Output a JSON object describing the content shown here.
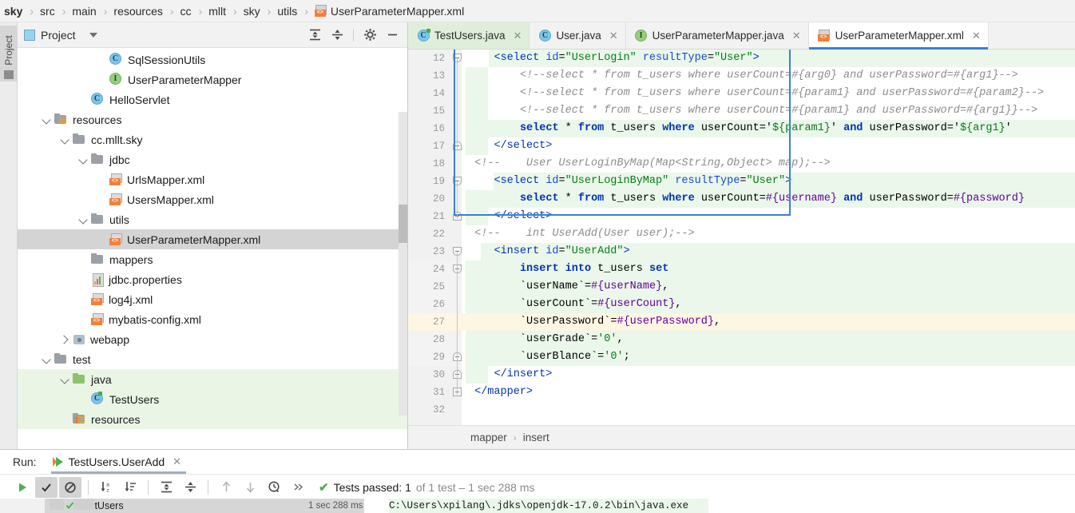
{
  "breadcrumb": {
    "items": [
      "sky",
      "src",
      "main",
      "resources",
      "cc",
      "mllt",
      "sky",
      "utils"
    ],
    "file": "UserParameterMapper.xml",
    "separator": "›"
  },
  "project_panel": {
    "title": "Project",
    "icons": [
      "expand-all-icon",
      "collapse-all-icon",
      "settings-gear-icon",
      "hide-icon"
    ],
    "vertical_tab": "Project",
    "tree": [
      {
        "label": "SqlSessionUtils",
        "icon": "java-class-icon",
        "glyph": "C",
        "indent": 5,
        "chevron": "none",
        "state": "normal"
      },
      {
        "label": "UserParameterMapper",
        "icon": "java-interface-icon",
        "glyph": "I",
        "indent": 5,
        "chevron": "none",
        "state": "normal"
      },
      {
        "label": "HelloServlet",
        "icon": "java-class-icon",
        "glyph": "C",
        "indent": 4,
        "chevron": "none",
        "state": "normal"
      },
      {
        "label": "resources",
        "icon": "resources-folder-icon",
        "glyph": "",
        "indent": 2,
        "chevron": "down",
        "state": "normal"
      },
      {
        "label": "cc.mllt.sky",
        "icon": "folder-icon",
        "glyph": "",
        "indent": 3,
        "chevron": "down",
        "state": "normal"
      },
      {
        "label": "jdbc",
        "icon": "folder-icon",
        "glyph": "",
        "indent": 4,
        "chevron": "down",
        "state": "normal"
      },
      {
        "label": "UrlsMapper.xml",
        "icon": "xml-file-icon",
        "glyph": "",
        "indent": 5,
        "chevron": "none",
        "state": "normal"
      },
      {
        "label": "UsersMapper.xml",
        "icon": "xml-file-icon",
        "glyph": "",
        "indent": 5,
        "chevron": "none",
        "state": "normal"
      },
      {
        "label": "utils",
        "icon": "folder-icon",
        "glyph": "",
        "indent": 4,
        "chevron": "down",
        "state": "normal"
      },
      {
        "label": "UserParameterMapper.xml",
        "icon": "xml-file-icon",
        "glyph": "",
        "indent": 5,
        "chevron": "none",
        "state": "selected"
      },
      {
        "label": "mappers",
        "icon": "folder-icon",
        "glyph": "",
        "indent": 4,
        "chevron": "none",
        "state": "normal"
      },
      {
        "label": "jdbc.properties",
        "icon": "properties-file-icon",
        "glyph": "",
        "indent": 4,
        "chevron": "none",
        "state": "normal"
      },
      {
        "label": "log4j.xml",
        "icon": "xml-file-icon",
        "glyph": "",
        "indent": 4,
        "chevron": "none",
        "state": "normal"
      },
      {
        "label": "mybatis-config.xml",
        "icon": "xml-file-icon",
        "glyph": "",
        "indent": 4,
        "chevron": "none",
        "state": "normal"
      },
      {
        "label": "webapp",
        "icon": "webapp-folder-icon",
        "glyph": "",
        "indent": 3,
        "chevron": "right",
        "state": "normal"
      },
      {
        "label": "test",
        "icon": "folder-icon",
        "glyph": "",
        "indent": 2,
        "chevron": "down",
        "state": "normal"
      },
      {
        "label": "java",
        "icon": "source-folder-icon",
        "glyph": "",
        "indent": 3,
        "chevron": "down",
        "state": "green"
      },
      {
        "label": "TestUsers",
        "icon": "java-test-class-icon",
        "glyph": "C",
        "indent": 4,
        "chevron": "none",
        "state": "green"
      },
      {
        "label": "resources",
        "icon": "test-resources-folder-icon",
        "glyph": "",
        "indent": 3,
        "chevron": "none",
        "state": "green"
      }
    ]
  },
  "editor": {
    "tabs": [
      {
        "label": "TestUsers.java",
        "icon": "java-test-class-icon",
        "glyph": "C",
        "style": "green",
        "close": "✕"
      },
      {
        "label": "User.java",
        "icon": "java-class-icon",
        "glyph": "C",
        "style": "plain",
        "close": "✕"
      },
      {
        "label": "UserParameterMapper.java",
        "icon": "java-interface-icon",
        "glyph": "I",
        "style": "plain",
        "close": "✕"
      },
      {
        "label": "UserParameterMapper.xml",
        "icon": "xml-file-icon",
        "glyph": "",
        "style": "active",
        "close": "✕"
      }
    ],
    "breadcrumb": {
      "items": [
        "mapper",
        "insert"
      ],
      "separator": "›"
    },
    "lines": [
      {
        "n": 12,
        "fold": "down",
        "bg": "none",
        "indent": 4,
        "tokens": [
          {
            "t": "<select ",
            "c": "s-tag"
          },
          {
            "t": "id",
            "c": "s-attr"
          },
          {
            "t": "=",
            "c": "s-punc"
          },
          {
            "t": "\"UserLogin\"",
            "c": "s-str"
          },
          {
            "t": " ",
            "c": "s-plain"
          },
          {
            "t": "resultType",
            "c": "s-attr"
          },
          {
            "t": "=",
            "c": "s-punc"
          },
          {
            "t": "\"User\"",
            "c": "s-str"
          },
          {
            "t": ">",
            "c": "s-tag"
          }
        ],
        "greenfrom": 34,
        "greenwidth": 760
      },
      {
        "n": 13,
        "fold": "none",
        "bg": "none",
        "indent": 8,
        "tokens": [
          {
            "t": "<!--select * from t_users where userCount=#{arg0} and userPassword=#{arg1}-->",
            "c": "s-com"
          }
        ],
        "greenfrom": 5,
        "greenwidth": 28
      },
      {
        "n": 14,
        "fold": "none",
        "bg": "none",
        "indent": 8,
        "tokens": [
          {
            "t": "<!--select * from t_users where userCount=#{param1} and userPassword=#{param2}-->",
            "c": "s-com"
          }
        ],
        "greenfrom": 5,
        "greenwidth": 28
      },
      {
        "n": 15,
        "fold": "none",
        "bg": "none",
        "indent": 8,
        "tokens": [
          {
            "t": "<!--select * from t_users where userCount=#{param1} and userPassword=#{arg1}}-->",
            "c": "s-com"
          }
        ],
        "greenfrom": 5,
        "greenwidth": 28
      },
      {
        "n": 16,
        "fold": "none",
        "bg": "none",
        "indent": 8,
        "tokens": [
          {
            "t": "select",
            "c": "s-kw"
          },
          {
            "t": " * ",
            "c": "s-plain"
          },
          {
            "t": "from",
            "c": "s-kw"
          },
          {
            "t": " t_users ",
            "c": "s-plain"
          },
          {
            "t": "where",
            "c": "s-kw"
          },
          {
            "t": " userCount=",
            "c": "s-plain"
          },
          {
            "t": "'",
            "c": "s-punc"
          },
          {
            "t": "${param1}",
            "c": "s-dollar"
          },
          {
            "t": "'",
            "c": "s-punc"
          },
          {
            "t": " ",
            "c": "s-plain"
          },
          {
            "t": "and",
            "c": "s-kw"
          },
          {
            "t": " userPassword=",
            "c": "s-plain"
          },
          {
            "t": "'",
            "c": "s-punc"
          },
          {
            "t": "${arg1}",
            "c": "s-dollar"
          },
          {
            "t": "'",
            "c": "s-punc"
          }
        ],
        "greenfrom": 5,
        "greenwidth": 789
      },
      {
        "n": 17,
        "fold": "up",
        "bg": "none",
        "indent": 4,
        "tokens": [
          {
            "t": "</select>",
            "c": "s-tag"
          }
        ],
        "greenfrom": 5,
        "greenwidth": 28
      },
      {
        "n": 18,
        "fold": "none",
        "bg": "none",
        "indent": 1,
        "tokens": [
          {
            "t": "<!--    User UserLoginByMap(Map<String,Object> map);-->",
            "c": "s-com"
          }
        ],
        "greenfrom": 0,
        "greenwidth": 0
      },
      {
        "n": 19,
        "fold": "down",
        "bg": "none",
        "indent": 4,
        "tokens": [
          {
            "t": "<select ",
            "c": "s-tag"
          },
          {
            "t": "id",
            "c": "s-attr"
          },
          {
            "t": "=",
            "c": "s-punc"
          },
          {
            "t": "\"UserLoginByMap\"",
            "c": "s-str"
          },
          {
            "t": " ",
            "c": "s-plain"
          },
          {
            "t": "resultType",
            "c": "s-attr"
          },
          {
            "t": "=",
            "c": "s-punc"
          },
          {
            "t": "\"User\"",
            "c": "s-str"
          },
          {
            "t": ">",
            "c": "s-tag"
          }
        ],
        "greenfrom": 40,
        "greenwidth": 754
      },
      {
        "n": 20,
        "fold": "none",
        "bg": "none",
        "indent": 8,
        "tokens": [
          {
            "t": "select",
            "c": "s-kw"
          },
          {
            "t": " * ",
            "c": "s-plain"
          },
          {
            "t": "from",
            "c": "s-kw"
          },
          {
            "t": " t_users ",
            "c": "s-plain"
          },
          {
            "t": "where",
            "c": "s-kw"
          },
          {
            "t": " userCount=",
            "c": "s-plain"
          },
          {
            "t": "#{username}",
            "c": "s-var"
          },
          {
            "t": " ",
            "c": "s-plain"
          },
          {
            "t": "and",
            "c": "s-kw"
          },
          {
            "t": " userPassword=",
            "c": "s-plain"
          },
          {
            "t": "#{password}",
            "c": "s-var"
          }
        ],
        "greenfrom": 5,
        "greenwidth": 789
      },
      {
        "n": 21,
        "fold": "up",
        "bg": "none",
        "indent": 4,
        "tokens": [
          {
            "t": "</select>",
            "c": "s-tag"
          }
        ],
        "greenfrom": 5,
        "greenwidth": 28
      },
      {
        "n": 22,
        "fold": "none",
        "bg": "none",
        "indent": 1,
        "tokens": [
          {
            "t": "<!--    int UserAdd(User user);-->",
            "c": "s-com"
          }
        ],
        "greenfrom": 0,
        "greenwidth": 0
      },
      {
        "n": 23,
        "fold": "down",
        "bg": "none",
        "indent": 4,
        "tokens": [
          {
            "t": "<insert ",
            "c": "s-tag"
          },
          {
            "t": "id",
            "c": "s-attr"
          },
          {
            "t": "=",
            "c": "s-punc"
          },
          {
            "t": "\"UserAdd\"",
            "c": "s-str"
          },
          {
            "t": ">",
            "c": "s-tag"
          }
        ],
        "greenfrom": 24,
        "greenwidth": 770
      },
      {
        "n": 24,
        "fold": "down",
        "bg": "green",
        "indent": 8,
        "tokens": [
          {
            "t": "insert",
            "c": "s-kw"
          },
          {
            "t": " ",
            "c": "s-plain"
          },
          {
            "t": "into",
            "c": "s-kw"
          },
          {
            "t": " t_users ",
            "c": "s-plain"
          },
          {
            "t": "set",
            "c": "s-kw"
          }
        ],
        "greenfrom": 5,
        "greenwidth": 789
      },
      {
        "n": 25,
        "fold": "none",
        "bg": "green",
        "indent": 8,
        "tokens": [
          {
            "t": "`userName`",
            "c": "s-plain"
          },
          {
            "t": "=",
            "c": "s-punc"
          },
          {
            "t": "#{userName}",
            "c": "s-var"
          },
          {
            "t": ",",
            "c": "s-punc"
          }
        ],
        "greenfrom": 5,
        "greenwidth": 789
      },
      {
        "n": 26,
        "fold": "none",
        "bg": "green",
        "indent": 8,
        "tokens": [
          {
            "t": "`userCount`",
            "c": "s-plain"
          },
          {
            "t": "=",
            "c": "s-punc"
          },
          {
            "t": "#{userCount}",
            "c": "s-var"
          },
          {
            "t": ",",
            "c": "s-punc"
          }
        ],
        "greenfrom": 5,
        "greenwidth": 789
      },
      {
        "n": 27,
        "fold": "none",
        "bg": "caret",
        "indent": 8,
        "tokens": [
          {
            "t": "`UserPassword`",
            "c": "s-plain"
          },
          {
            "t": "=",
            "c": "s-punc"
          },
          {
            "t": "#{userPassword}",
            "c": "s-var"
          },
          {
            "t": ",",
            "c": "s-punc"
          }
        ],
        "greenfrom": 0,
        "greenwidth": 0
      },
      {
        "n": 28,
        "fold": "none",
        "bg": "green",
        "indent": 8,
        "tokens": [
          {
            "t": "`userGrade`",
            "c": "s-plain"
          },
          {
            "t": "=",
            "c": "s-punc"
          },
          {
            "t": "'0'",
            "c": "s-str"
          },
          {
            "t": ",",
            "c": "s-punc"
          }
        ],
        "greenfrom": 5,
        "greenwidth": 789
      },
      {
        "n": 29,
        "fold": "up",
        "bg": "green",
        "indent": 8,
        "tokens": [
          {
            "t": "`userBlance`",
            "c": "s-plain"
          },
          {
            "t": "=",
            "c": "s-punc"
          },
          {
            "t": "'0'",
            "c": "s-str"
          },
          {
            "t": ";",
            "c": "s-punc"
          }
        ],
        "greenfrom": 5,
        "greenwidth": 789
      },
      {
        "n": 30,
        "fold": "up",
        "bg": "none",
        "indent": 4,
        "tokens": [
          {
            "t": "</insert>",
            "c": "s-tag"
          }
        ],
        "greenfrom": 5,
        "greenwidth": 28
      },
      {
        "n": 31,
        "fold": "minus",
        "bg": "none",
        "indent": 1,
        "tokens": [
          {
            "t": "</mapper>",
            "c": "s-tag"
          }
        ],
        "greenfrom": 0,
        "greenwidth": 0
      },
      {
        "n": 32,
        "fold": "none",
        "bg": "none",
        "indent": 0,
        "tokens": [
          {
            "t": "",
            "c": "s-plain"
          }
        ],
        "greenfrom": 0,
        "greenwidth": 0
      }
    ]
  },
  "run_panel": {
    "label": "Run:",
    "tab": "TestUsers.UserAdd",
    "tab_close": "✕",
    "toolbar": [
      "rerun-icon",
      "show-passed-icon",
      "hide-ignored-icon",
      "sort-alphabetically-icon",
      "sort-by-duration-icon",
      "expand-all-icon",
      "collapse-all-icon",
      "previous-failed-icon",
      "next-failed-icon",
      "history-icon",
      "more-icon"
    ],
    "status_check": "✔",
    "status_strong": "Tests passed: 1",
    "status_dim": "of 1 test – 1 sec 288 ms",
    "tree_row": "TestUsers",
    "tree_time": "1 sec 288 ms",
    "console_line": "C:\\Users\\xpilang\\.jdks\\openjdk-17.0.2\\bin\\java.exe"
  },
  "colors": {
    "accent": "#3c7fd4",
    "pass": "#4caf50",
    "green_hl": "#eaf7ea",
    "caret_hl": "#fdf6e3",
    "xml_orange": "#f2803c"
  }
}
